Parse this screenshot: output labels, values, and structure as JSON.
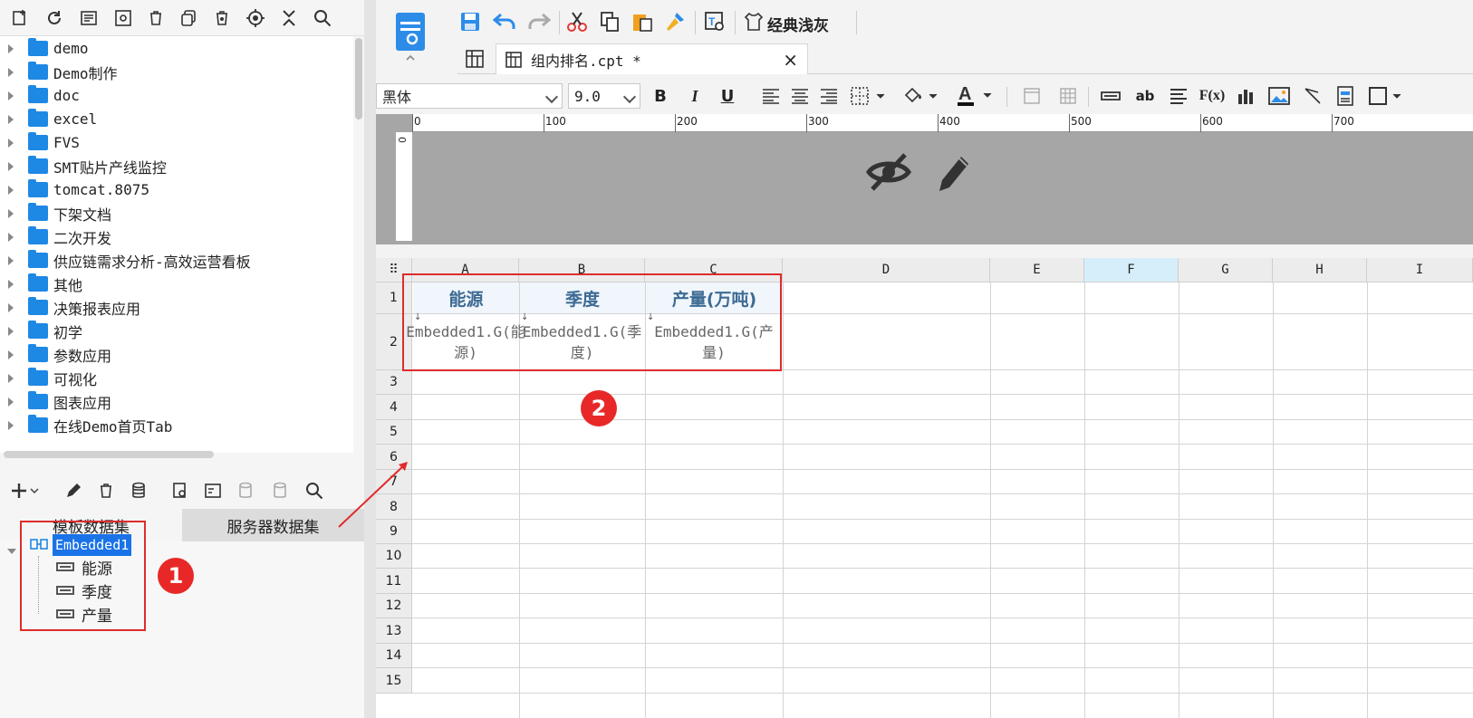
{
  "left_toolbar_icons": [
    "new-file-icon",
    "refresh-icon",
    "open-icon",
    "settings-icon",
    "delete-icon",
    "copy-icon",
    "lock-icon",
    "locate-icon",
    "collapse-icon",
    "search-icon"
  ],
  "tree": {
    "items": [
      {
        "label": "demo"
      },
      {
        "label": "Demo制作"
      },
      {
        "label": "doc"
      },
      {
        "label": "excel"
      },
      {
        "label": "FVS"
      },
      {
        "label": "SMT贴片产线监控"
      },
      {
        "label": "tomcat.8075"
      },
      {
        "label": "下架文档"
      },
      {
        "label": "二次开发"
      },
      {
        "label": "供应链需求分析-高效运营看板"
      },
      {
        "label": "其他"
      },
      {
        "label": "决策报表应用"
      },
      {
        "label": "初学"
      },
      {
        "label": "参数应用"
      },
      {
        "label": "可视化"
      },
      {
        "label": "图表应用"
      },
      {
        "label": "在线Demo首页Tab"
      }
    ]
  },
  "dataset_panel": {
    "tabs": {
      "template": "模板数据集",
      "server": "服务器数据集"
    },
    "dataset_name": "Embedded1",
    "fields": [
      {
        "label": "能源"
      },
      {
        "label": "季度"
      },
      {
        "label": "产量"
      }
    ]
  },
  "menu": {
    "theme_label": "经典浅灰"
  },
  "doc_tab": {
    "title": "组内排名.cpt *",
    "close": "×"
  },
  "format": {
    "font": "黑体",
    "size": "9.0",
    "bold": "B",
    "italic": "I",
    "underline": "U",
    "text_ab": "ab",
    "fx": "F(x)",
    "color_a": "A"
  },
  "ruler": {
    "marks": [
      "0",
      "100",
      "200",
      "300",
      "400",
      "500",
      "600",
      "700"
    ],
    "v_mark": "0"
  },
  "grid": {
    "columns": [
      "A",
      "B",
      "C",
      "D",
      "E",
      "F",
      "G",
      "H",
      "I"
    ],
    "selected_column": "F",
    "rows": [
      "1",
      "2",
      "3",
      "4",
      "5",
      "6",
      "7",
      "8",
      "9",
      "10",
      "11",
      "12",
      "13",
      "14",
      "15"
    ],
    "header_cells": [
      "能源",
      "季度",
      "产量(万吨)"
    ],
    "data_cells": [
      "Embedded1.G(能源)",
      "Embedded1.G(季度)",
      "Embedded1.G(产量)"
    ]
  },
  "annotations": {
    "badge1": "1",
    "badge2": "2",
    "highlight_color": "#e02b2b"
  }
}
